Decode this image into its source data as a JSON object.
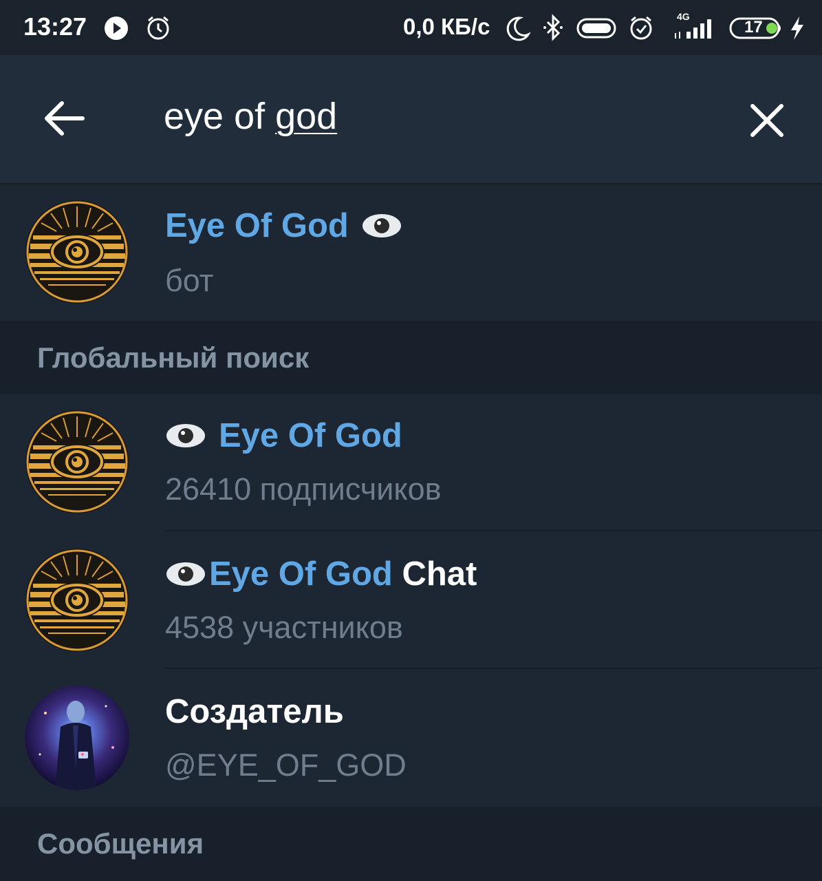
{
  "status_bar": {
    "time": "13:27",
    "net_speed": "0,0 КБ/с",
    "network_type": "4G",
    "battery_level": "17",
    "icons": [
      "play-circle-icon",
      "alarm-icon",
      "moon-icon",
      "bluetooth-icon",
      "toggle-icon",
      "alarm-icon",
      "signal-icon",
      "battery-icon",
      "charging-icon"
    ]
  },
  "search": {
    "query_plain": "eye of ",
    "query_underlined": "god",
    "back_icon": "arrow-left-icon",
    "clear_icon": "close-icon"
  },
  "local_results": [
    {
      "title_highlight": "Eye Of God",
      "title_emoji": "eye-emoji",
      "subtitle": "бот",
      "avatar": "eye-of-god-logo"
    }
  ],
  "global_section": {
    "label": "Глобальный поиск"
  },
  "global_results": [
    {
      "title_prefix_emoji": "eye-emoji",
      "title_highlight": "Eye Of God",
      "title_rest": "",
      "subtitle": "26410 подписчиков",
      "avatar": "eye-of-god-logo"
    },
    {
      "title_prefix_emoji": "eye-emoji",
      "title_highlight": "Eye Of God",
      "title_rest": " Chat",
      "subtitle": "4538 участников",
      "avatar": "eye-of-god-logo"
    },
    {
      "title_plain": "Создатель",
      "subtitle": "@EYE_OF_GOD",
      "avatar": "creator-photo"
    }
  ],
  "messages_section": {
    "label": "Сообщения"
  },
  "colors": {
    "background": "#1d2733",
    "header": "#212d3b",
    "section": "#17202b",
    "highlight": "#5fa8e5",
    "subtitle": "#6f7d8c",
    "avatar_gold": "#e0a73e"
  }
}
